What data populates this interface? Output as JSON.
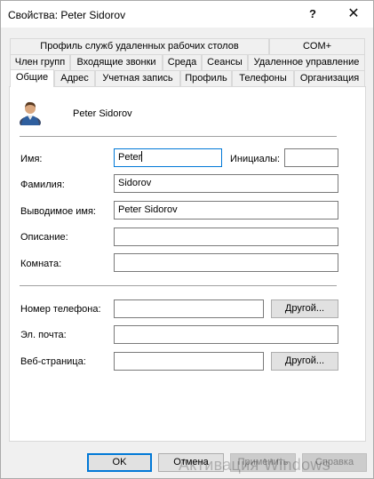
{
  "window": {
    "title": "Свойства: Peter Sidorov",
    "help_glyph": "?",
    "close_glyph": "✕"
  },
  "tabs": {
    "row1": [
      "Профиль служб удаленных рабочих столов",
      "COM+"
    ],
    "row2": [
      "Член групп",
      "Входящие звонки",
      "Среда",
      "Сеансы",
      "Удаленное управление"
    ],
    "row3": [
      "Общие",
      "Адрес",
      "Учетная запись",
      "Профиль",
      "Телефоны",
      "Организация"
    ],
    "active": "Общие"
  },
  "general": {
    "display_name_header": "Peter Sidorov",
    "first_name_label": "Имя:",
    "first_name_value": "Peter",
    "initials_label": "Инициалы:",
    "initials_value": "",
    "last_name_label": "Фамилия:",
    "last_name_value": "Sidorov",
    "display_name_label": "Выводимое имя:",
    "display_name_value": "Peter Sidorov",
    "description_label": "Описание:",
    "description_value": "",
    "office_label": "Комната:",
    "office_value": "",
    "phone_label": "Номер телефона:",
    "phone_value": "",
    "phone_other_button": "Другой...",
    "email_label": "Эл. почта:",
    "email_value": "",
    "webpage_label": "Веб-страница:",
    "webpage_value": "",
    "webpage_other_button": "Другой..."
  },
  "footer": {
    "ok": "OK",
    "cancel": "Отмена",
    "apply": "Применить",
    "help": "Справка"
  },
  "watermark": "Активация Windows",
  "icons": {
    "avatar": "user-avatar-icon",
    "help": "question-icon",
    "close": "close-icon"
  },
  "colors": {
    "focus_border": "#0078d7",
    "dialog_bg": "#f0f0f0"
  }
}
